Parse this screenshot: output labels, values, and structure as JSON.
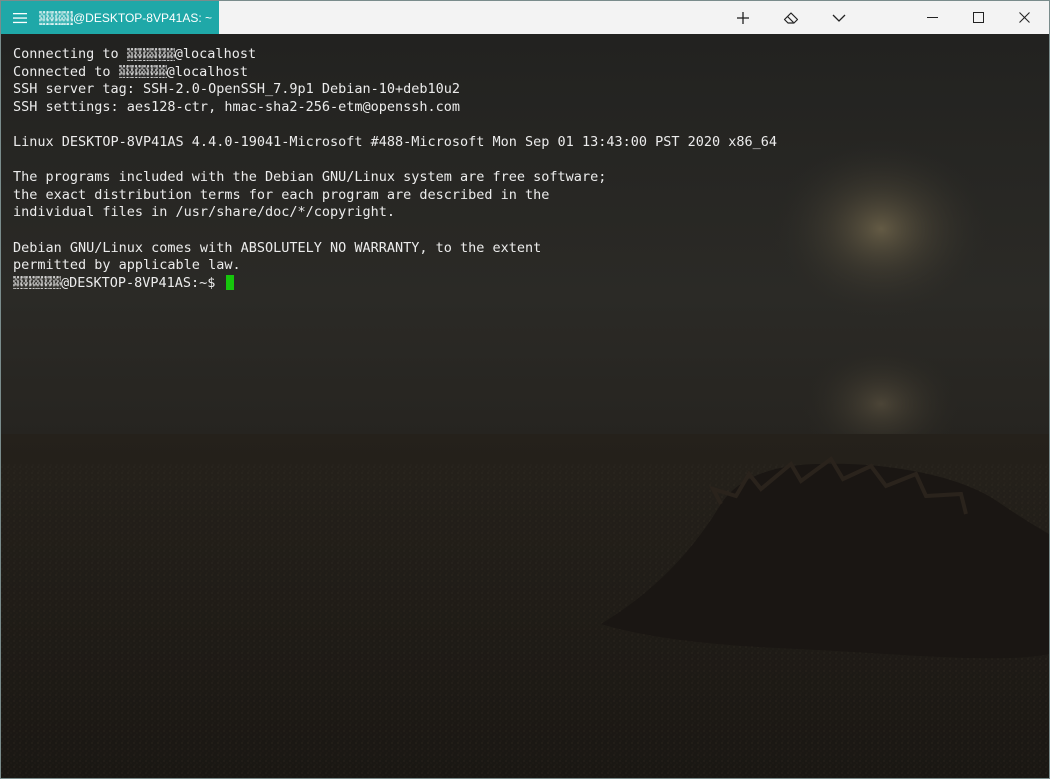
{
  "tab": {
    "title": "@DESKTOP-8VP41AS: ~"
  },
  "toolbar": {
    "new_tab_icon": "plus-icon",
    "tab_settings_icon": "eraser-icon",
    "dropdown_icon": "chevron-down-icon"
  },
  "window_controls": {
    "minimize_icon": "minimize-icon",
    "maximize_icon": "maximize-icon",
    "close_icon": "close-icon"
  },
  "terminal": {
    "lines": [
      {
        "prefix": "Connecting to ",
        "redacted": true,
        "suffix": "@localhost"
      },
      {
        "prefix": "Connected to ",
        "redacted": true,
        "suffix": "@localhost"
      },
      {
        "text": "SSH server tag: SSH-2.0-OpenSSH_7.9p1 Debian-10+deb10u2"
      },
      {
        "text": "SSH settings: aes128-ctr, hmac-sha2-256-etm@openssh.com"
      },
      {
        "text": ""
      },
      {
        "text": "Linux DESKTOP-8VP41AS 4.4.0-19041-Microsoft #488-Microsoft Mon Sep 01 13:43:00 PST 2020 x86_64"
      },
      {
        "text": ""
      },
      {
        "text": "The programs included with the Debian GNU/Linux system are free software;"
      },
      {
        "text": "the exact distribution terms for each program are described in the"
      },
      {
        "text": "individual files in /usr/share/doc/*/copyright."
      },
      {
        "text": ""
      },
      {
        "text": "Debian GNU/Linux comes with ABSOLUTELY NO WARRANTY, to the extent"
      },
      {
        "text": "permitted by applicable law."
      }
    ],
    "prompt": "@DESKTOP-8VP41AS:~$ ",
    "cursor_color": "#16c60c",
    "accent_color": "#1fa8a8"
  }
}
